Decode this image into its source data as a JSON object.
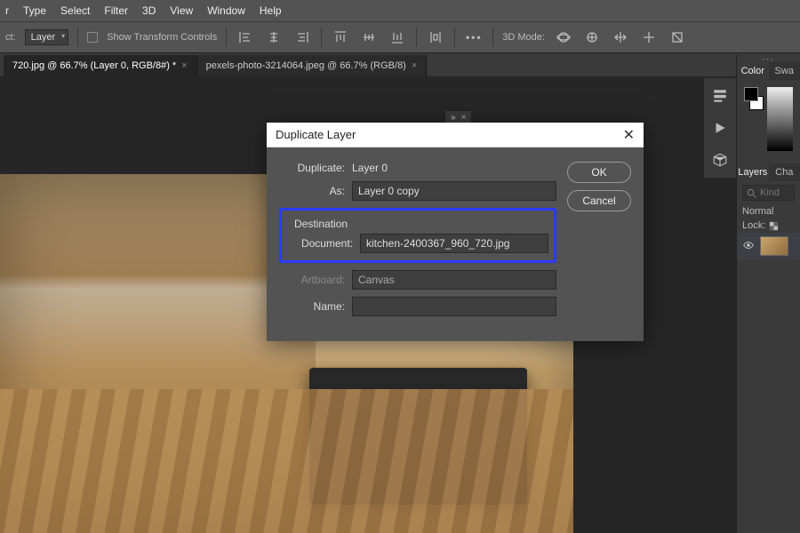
{
  "menu": {
    "items": [
      "r",
      "Type",
      "Select",
      "Filter",
      "3D",
      "View",
      "Window",
      "Help"
    ]
  },
  "options": {
    "left_label": "ct:",
    "layer_dd": "Layer",
    "show_transform": "Show Transform Controls",
    "mode_label": "3D Mode:"
  },
  "tabs": [
    {
      "label": "720.jpg @ 66.7% (Layer 0, RGB/8#) *",
      "active": true
    },
    {
      "label": "pexels-photo-3214064.jpeg @ 66.7% (RGB/8)",
      "active": false
    }
  ],
  "floatbar": {
    "chev": "»"
  },
  "dialog": {
    "title": "Duplicate Layer",
    "duplicate_label": "Duplicate:",
    "duplicate_value": "Layer 0",
    "as_label": "As:",
    "as_value": "Layer 0 copy",
    "destination_label": "Destination",
    "document_label": "Document:",
    "document_value": "kitchen-2400367_960_720.jpg",
    "artboard_label": "Artboard:",
    "artboard_value": "Canvas",
    "name_label": "Name:",
    "name_value": "",
    "ok": "OK",
    "cancel": "Cancel"
  },
  "panels": {
    "color_tab": "Color",
    "swatches_tab": "Swa",
    "layers_tab": "Layers",
    "channels_tab": "Cha",
    "search_placeholder": "Kind",
    "blend_mode": "Normal",
    "lock_label": "Lock:"
  }
}
